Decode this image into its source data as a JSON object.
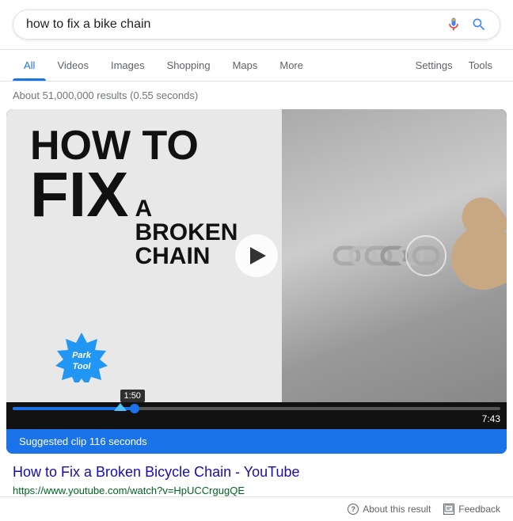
{
  "search": {
    "query": "how to fix a bike chain",
    "placeholder": "how to fix a bike chain"
  },
  "nav": {
    "tabs": [
      {
        "label": "All",
        "active": true
      },
      {
        "label": "Videos",
        "active": false
      },
      {
        "label": "Images",
        "active": false
      },
      {
        "label": "Shopping",
        "active": false
      },
      {
        "label": "Maps",
        "active": false
      },
      {
        "label": "More",
        "active": false
      }
    ],
    "right_tabs": [
      "Settings",
      "Tools"
    ]
  },
  "results_count": "About 51,000,000 results (0.55 seconds)",
  "video": {
    "title_how": "HOW TO",
    "title_fix": "FIX",
    "title_sub": "A BROKEN\nCHAIN",
    "brand": "ParkTool",
    "play_button_aria": "Play video",
    "duration": "7:43",
    "current_time": "1:50",
    "suggested_clip": "Suggested clip 116 seconds"
  },
  "result": {
    "title": "How to Fix a Broken Bicycle Chain - YouTube",
    "url": "https://www.youtube.com/watch?v=HpUCCrgugQE"
  },
  "bottom": {
    "about_label": "About this result",
    "feedback_label": "Feedback"
  }
}
